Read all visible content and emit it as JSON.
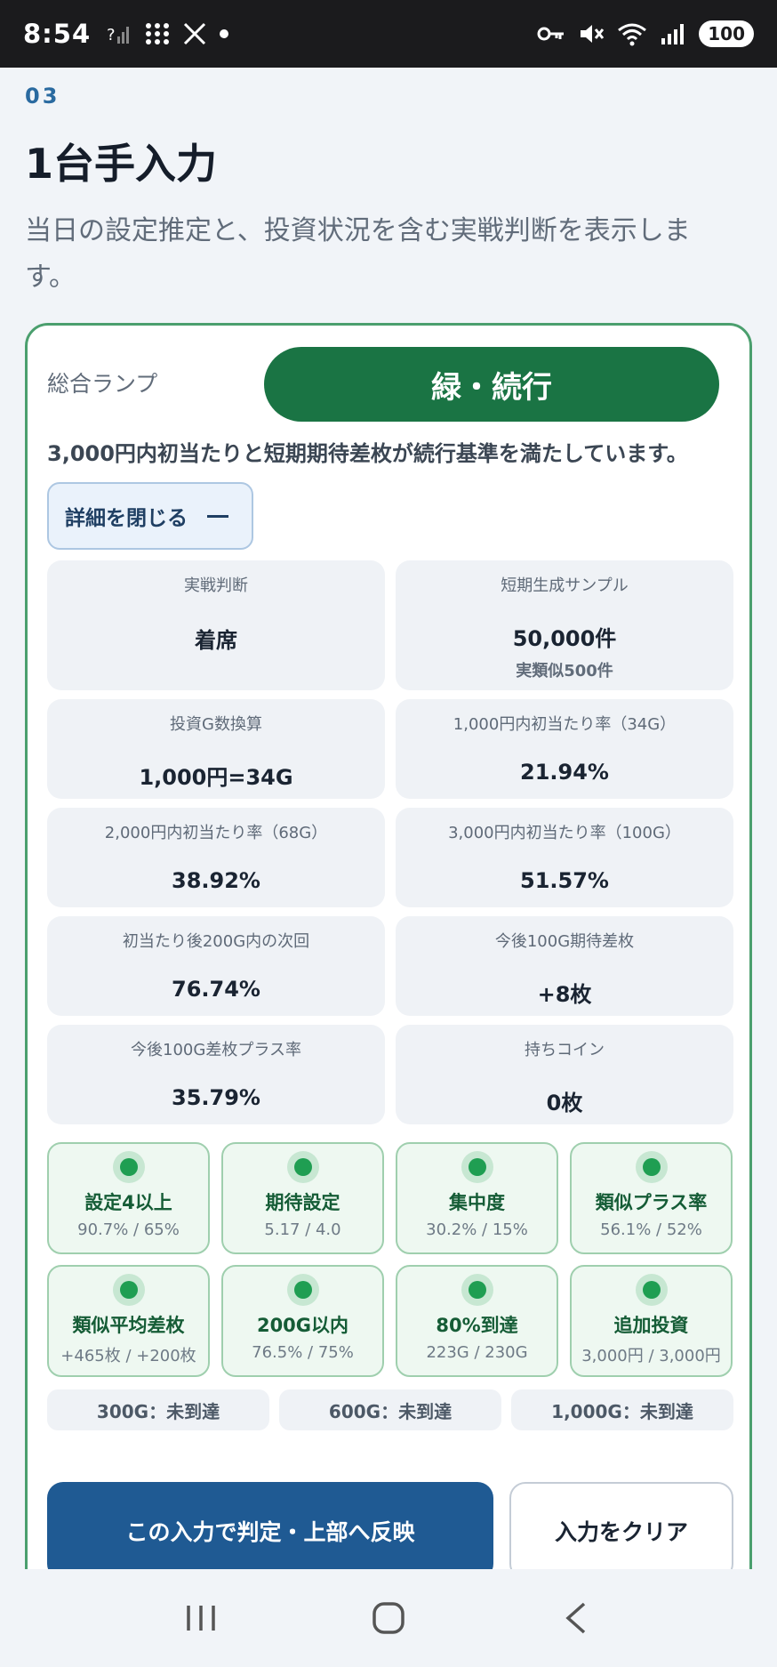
{
  "status_bar": {
    "time": "8:54",
    "battery": "100"
  },
  "header": {
    "section_number": "03",
    "title": "1台手入力",
    "description": "当日の設定推定と、投資状況を含む実戦判断を表示します。"
  },
  "lamp": {
    "label": "総合ランプ",
    "status": "緑・続行",
    "reason": "3,000円内初当たりと短期期待差枚が続行基準を満たしています。",
    "color": "#1a7444"
  },
  "details_toggle": {
    "label": "詳細を閉じる"
  },
  "stats": [
    {
      "label": "実戦判断",
      "value": "着席"
    },
    {
      "label": "短期生成サンプル",
      "value": "50,000件",
      "sub": "実類似500件"
    },
    {
      "label": "投資G数換算",
      "value": "1,000円=34G"
    },
    {
      "label": "1,000円内初当たり率（34G）",
      "value": "21.94%"
    },
    {
      "label": "2,000円内初当たり率（68G）",
      "value": "38.92%"
    },
    {
      "label": "3,000円内初当たり率（100G）",
      "value": "51.57%"
    },
    {
      "label": "初当たり後200G内の次回",
      "value": "76.74%"
    },
    {
      "label": "今後100G期待差枚",
      "value": "+8枚"
    },
    {
      "label": "今後100G差枚プラス率",
      "value": "35.79%"
    },
    {
      "label": "持ちコイン",
      "value": "0枚"
    }
  ],
  "checks": [
    {
      "title": "設定4以上",
      "values": "90.7% / 65%"
    },
    {
      "title": "期待設定",
      "values": "5.17 / 4.0"
    },
    {
      "title": "集中度",
      "values": "30.2% / 15%"
    },
    {
      "title": "類似プラス率",
      "values": "56.1% / 52%"
    },
    {
      "title": "類似平均差枚",
      "values": "+465枚 / +200枚"
    },
    {
      "title": "200G以内",
      "values": "76.5% / 75%"
    },
    {
      "title": "80%到達",
      "values": "223G / 230G"
    },
    {
      "title": "追加投資",
      "values": "3,000円 / 3,000円"
    }
  ],
  "milestones": [
    {
      "label": "300G：未到達"
    },
    {
      "label": "600G：未到達"
    },
    {
      "label": "1,000G：未到達"
    }
  ],
  "actions": {
    "judge": "この入力で判定・上部へ反映",
    "clear": "入力をクリア"
  }
}
